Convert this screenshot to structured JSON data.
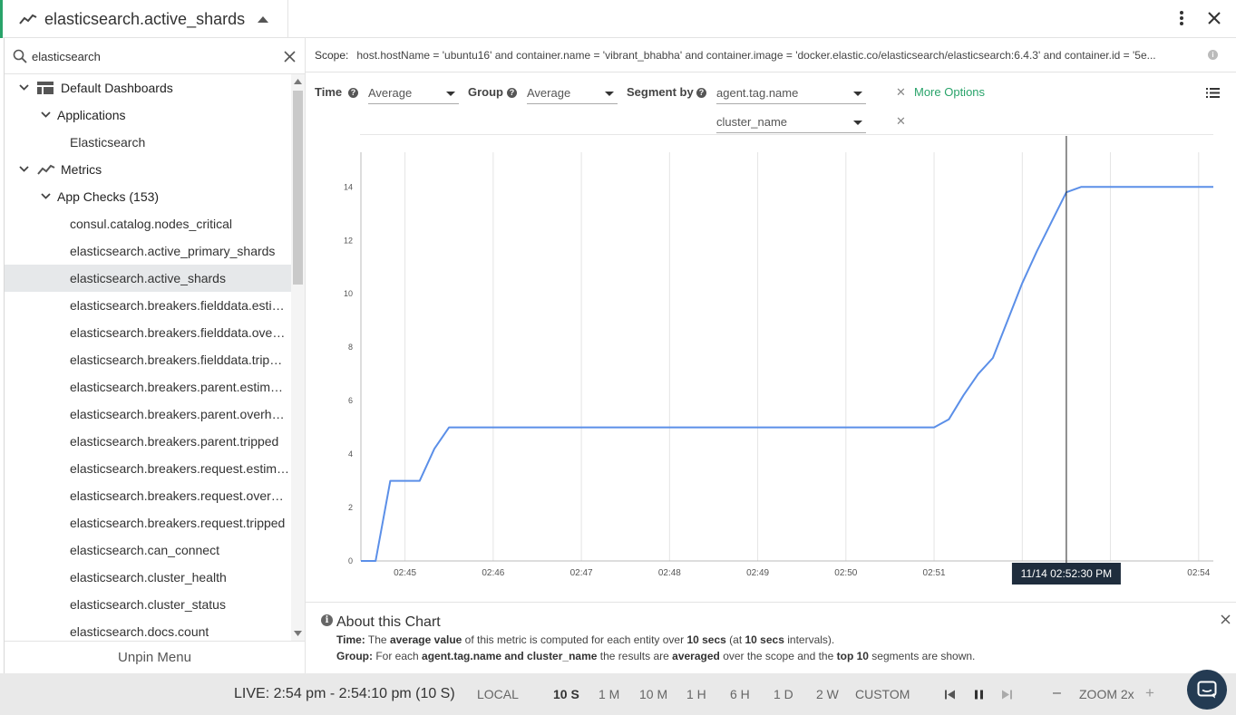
{
  "header": {
    "title": "elasticsearch.active_shards",
    "title_icon": "line-chart-icon",
    "collapse_icon": "caret-up-icon",
    "more_icon": "more-vertical-icon",
    "close_icon": "close-icon"
  },
  "sidebar": {
    "search": {
      "value": "elasticsearch",
      "placeholder": "Search"
    },
    "tree": [
      {
        "label": "Default Dashboards",
        "level": 0,
        "expanded": true,
        "icon": "dashboard-icon"
      },
      {
        "label": "Applications",
        "level": 1,
        "expanded": true
      },
      {
        "label": "Elasticsearch",
        "level": 2
      },
      {
        "label": "Metrics",
        "level": 0,
        "expanded": true,
        "icon": "metrics-icon"
      },
      {
        "label": "App Checks (153)",
        "level": 1,
        "expanded": true
      },
      {
        "label": "consul.catalog.nodes_critical",
        "level": 2
      },
      {
        "label": "elasticsearch.active_primary_shards",
        "level": 2
      },
      {
        "label": "elasticsearch.active_shards",
        "level": 2,
        "selected": true
      },
      {
        "label": "elasticsearch.breakers.fielddata.estim...",
        "level": 2
      },
      {
        "label": "elasticsearch.breakers.fielddata.overh...",
        "level": 2
      },
      {
        "label": "elasticsearch.breakers.fielddata.tripped",
        "level": 2
      },
      {
        "label": "elasticsearch.breakers.parent.estimat...",
        "level": 2
      },
      {
        "label": "elasticsearch.breakers.parent.overhead",
        "level": 2
      },
      {
        "label": "elasticsearch.breakers.parent.tripped",
        "level": 2
      },
      {
        "label": "elasticsearch.breakers.request.estima...",
        "level": 2
      },
      {
        "label": "elasticsearch.breakers.request.overhe...",
        "level": 2
      },
      {
        "label": "elasticsearch.breakers.request.tripped",
        "level": 2
      },
      {
        "label": "elasticsearch.can_connect",
        "level": 2
      },
      {
        "label": "elasticsearch.cluster_health",
        "level": 2
      },
      {
        "label": "elasticsearch.cluster_status",
        "level": 2
      },
      {
        "label": "elasticsearch.docs.count",
        "level": 2
      }
    ],
    "unpin_label": "Unpin Menu"
  },
  "scope": {
    "label": "Scope:",
    "value": "host.hostName = 'ubuntu16' and container.name = 'vibrant_bhabha' and container.image = 'docker.elastic.co/elasticsearch/elasticsearch:6.4.3' and container.id = '5e..."
  },
  "controls": {
    "time_label": "Time",
    "time_value": "Average",
    "group_label": "Group",
    "group_value": "Average",
    "segment_label": "Segment by",
    "segment_values": [
      "agent.tag.name",
      "cluster_name"
    ],
    "more_options": "More Options",
    "list_icon": "list-icon"
  },
  "chart_data": {
    "type": "line",
    "x": [
      "02:44:30",
      "02:44:40",
      "02:44:50",
      "02:45:00",
      "02:45:10",
      "02:45:20",
      "02:45:30",
      "02:51:00",
      "02:51:10",
      "02:51:20",
      "02:51:30",
      "02:51:40",
      "02:51:50",
      "02:52:00",
      "02:52:10",
      "02:52:20",
      "02:52:30",
      "02:52:40",
      "02:54:10"
    ],
    "series": [
      {
        "values": [
          0,
          0,
          3,
          3,
          3,
          4.2,
          5,
          5,
          5.3,
          6.2,
          7,
          7.6,
          9,
          10.4,
          11.6,
          12.7,
          13.8,
          14,
          14
        ]
      }
    ],
    "x_ticks": [
      "02:45",
      "02:46",
      "02:47",
      "02:48",
      "02:49",
      "02:50",
      "02:51",
      "02:52",
      "02:53",
      "02:54"
    ],
    "x_tick_labels": [
      "02:45",
      "02:46",
      "02:47",
      "02:48",
      "02:49",
      "02:50",
      "02:51",
      "",
      "",
      "02:54"
    ],
    "x_range": [
      "02:44:30",
      "02:54:10"
    ],
    "y_ticks": [
      0,
      2,
      4,
      6,
      8,
      10,
      12,
      14
    ],
    "ylim": [
      0,
      15.3
    ],
    "grid": "vertical",
    "line_color": "#5b8fe8",
    "hover_time": "02:52:30",
    "hover_label": "11/14 02:52:30 PM"
  },
  "about": {
    "title": "About this Chart",
    "time_prefix": "Time:",
    "time_text_1": " The ",
    "time_bold_1": "average value",
    "time_text_2": " of this metric is computed for each entity over ",
    "time_bold_2": "10 secs",
    "time_text_3": " (at ",
    "time_bold_3": "10 secs",
    "time_text_4": " intervals).",
    "group_prefix": "Group:",
    "group_text_1": " For each ",
    "group_bold_1": "agent.tag.name and cluster_name",
    "group_text_2": " the results are ",
    "group_bold_2": "averaged",
    "group_text_3": " over the scope and the ",
    "group_bold_3": "top 10",
    "group_text_4": " segments are shown."
  },
  "timebar": {
    "live": "LIVE: 2:54 pm - 2:54:10 pm (10 S)",
    "timezone": "LOCAL",
    "ranges": [
      "10 S",
      "1 M",
      "10 M",
      "1 H",
      "6 H",
      "1 D",
      "2 W",
      "CUSTOM"
    ],
    "active_range": "10 S",
    "zoom_label": "ZOOM 2x",
    "zoom_out": "–",
    "zoom_in": "+"
  }
}
